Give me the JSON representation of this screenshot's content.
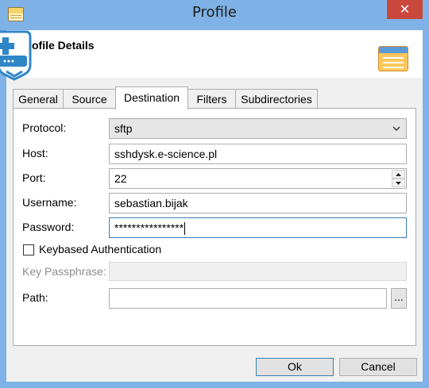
{
  "window": {
    "title": "Profile"
  },
  "header": {
    "title": "ofile Details"
  },
  "tabs": [
    {
      "label": "General"
    },
    {
      "label": "Source"
    },
    {
      "label": "Destination"
    },
    {
      "label": "Filters"
    },
    {
      "label": "Subdirectories"
    }
  ],
  "active_tab": "Destination",
  "form": {
    "protocol": {
      "label": "Protocol:",
      "value": "sftp"
    },
    "host": {
      "label": "Host:",
      "value": "sshdysk.e-science.pl"
    },
    "port": {
      "label": "Port:",
      "value": "22"
    },
    "username": {
      "label": "Username:",
      "value": "sebastian.bijak"
    },
    "password": {
      "label": "Password:",
      "value": "****************"
    },
    "keybased": {
      "label": "Keybased Authentication",
      "checked": false
    },
    "key_passphrase": {
      "label": "Key Passphrase:",
      "value": ""
    },
    "path": {
      "label": "Path:",
      "value": "",
      "browse_label": "..."
    }
  },
  "buttons": {
    "ok": "Ok",
    "cancel": "Cancel"
  },
  "colors": {
    "titlebar": "#7fb2e6",
    "close": "#c9483c",
    "focus_border": "#3c7fb1"
  },
  "icons": [
    "app-icon",
    "close-icon",
    "profile-header-icon",
    "add-badge-icon",
    "chevron-down-icon",
    "spin-up-icon",
    "spin-down-icon"
  ]
}
